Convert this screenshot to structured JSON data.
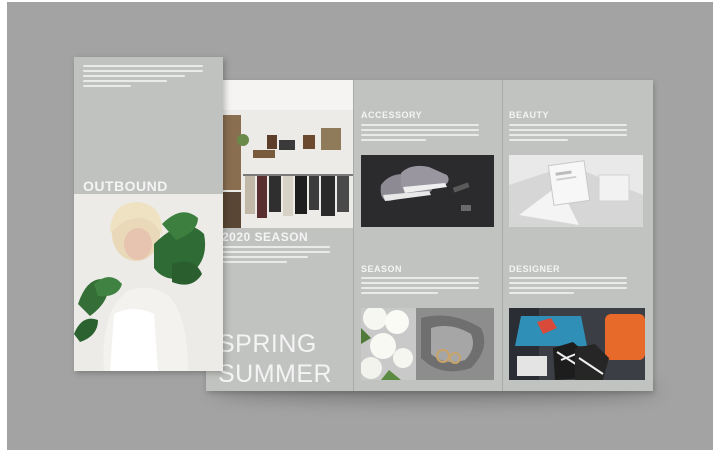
{
  "brochure": {
    "front_title": "OUTBOUND",
    "season_heading": "2020 SEASON",
    "big_title_line1": "SPRING",
    "big_title_line2": "SUMMER",
    "sections": {
      "accessory": "ACCESSORY",
      "beauty": "BEAUTY",
      "season": "SEASON",
      "designer": "DESIGNER"
    }
  },
  "colors": {
    "backdrop": "#a3a3a3",
    "panel": "#c1c3c1",
    "text": "#f4f4f4"
  }
}
